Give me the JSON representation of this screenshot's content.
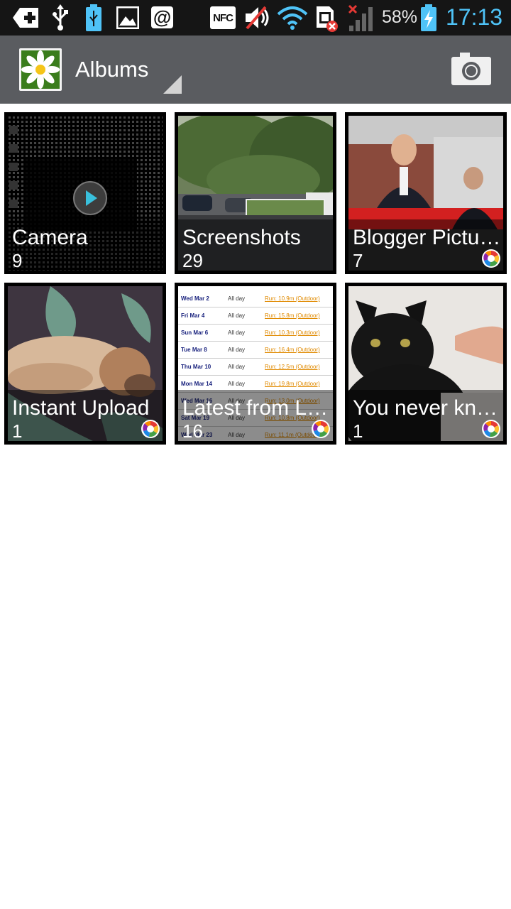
{
  "status_bar": {
    "nfc_label": "NFC",
    "at_label": "@",
    "battery_percent": "58%",
    "time": "17:13",
    "accent": "#4fc3f7"
  },
  "action_bar": {
    "title": "Albums",
    "background": "#5a5c60"
  },
  "albums": [
    {
      "name": "Camera",
      "count": "9"
    },
    {
      "name": "Screenshots",
      "count": "29"
    },
    {
      "name": "Blogger Pictu…",
      "count": "7"
    },
    {
      "name": "Instant Upload",
      "count": "1"
    },
    {
      "name": "Latest from L…",
      "count": "16"
    },
    {
      "name": "You never kn…",
      "count": "1"
    }
  ],
  "calendar_thumb": {
    "rows": [
      {
        "date": "Wed Mar 2",
        "all": "All day",
        "run": "Run: 10.9m (Outdoor)"
      },
      {
        "date": "Fri Mar 4",
        "all": "All day",
        "run": "Run: 15.8m (Outdoor)"
      },
      {
        "date": "Sun Mar 6",
        "all": "All day",
        "run": "Run: 10.3m (Outdoor)"
      },
      {
        "date": "Tue Mar 8",
        "all": "All day",
        "run": "Run: 16.4m (Outdoor)"
      },
      {
        "date": "Thu Mar 10",
        "all": "All day",
        "run": "Run: 12.5m (Outdoor)"
      },
      {
        "date": "Mon Mar 14",
        "all": "All day",
        "run": "Run: 19.8m (Outdoor)"
      },
      {
        "date": "Wed Mar 16",
        "all": "All day",
        "run": "Run: 13.0m (Outdoor)"
      },
      {
        "date": "Sat Mar 19",
        "all": "All day",
        "run": "Run: 10.8m (Outdoor)"
      },
      {
        "date": "Wed Mar 23",
        "all": "All day",
        "run": "Run: 11.1m (Outdoor)"
      }
    ]
  }
}
